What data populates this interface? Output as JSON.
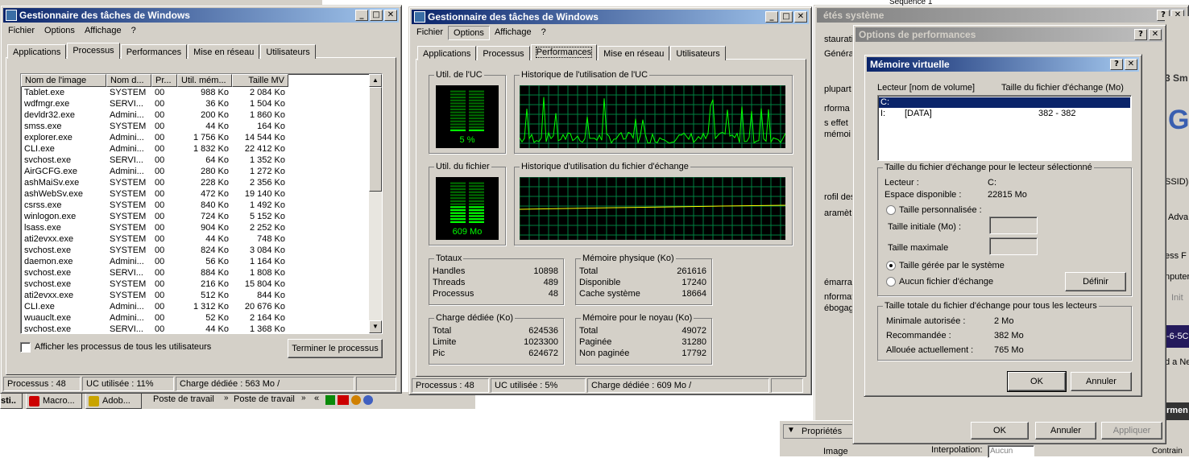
{
  "taskman_left": {
    "title": "Gestionnaire des tâches de Windows",
    "menu": [
      "Fichier",
      "Options",
      "Affichage",
      "?"
    ],
    "tabs": [
      "Applications",
      "Processus",
      "Performances",
      "Mise en réseau",
      "Utilisateurs"
    ],
    "active_tab": 1,
    "columns": [
      "Nom de l'image",
      "Nom d...",
      "Pr...",
      "Util. mém...",
      "Taille MV"
    ],
    "rows": [
      [
        "Tablet.exe",
        "SYSTEM",
        "00",
        "988 Ko",
        "2 084 Ko"
      ],
      [
        "wdfmgr.exe",
        "SERVI...",
        "00",
        "36 Ko",
        "1 504 Ko"
      ],
      [
        "devldr32.exe",
        "Admini...",
        "00",
        "200 Ko",
        "1 860 Ko"
      ],
      [
        "smss.exe",
        "SYSTEM",
        "00",
        "44 Ko",
        "164 Ko"
      ],
      [
        "explorer.exe",
        "Admini...",
        "00",
        "1 756 Ko",
        "14 544 Ko"
      ],
      [
        "CLI.exe",
        "Admini...",
        "00",
        "1 832 Ko",
        "22 412 Ko"
      ],
      [
        "svchost.exe",
        "SERVI...",
        "00",
        "64 Ko",
        "1 352 Ko"
      ],
      [
        "AirGCFG.exe",
        "Admini...",
        "00",
        "280 Ko",
        "1 272 Ko"
      ],
      [
        "ashMaiSv.exe",
        "SYSTEM",
        "00",
        "228 Ko",
        "2 356 Ko"
      ],
      [
        "ashWebSv.exe",
        "SYSTEM",
        "00",
        "472 Ko",
        "19 140 Ko"
      ],
      [
        "csrss.exe",
        "SYSTEM",
        "00",
        "840 Ko",
        "1 492 Ko"
      ],
      [
        "winlogon.exe",
        "SYSTEM",
        "00",
        "724 Ko",
        "5 152 Ko"
      ],
      [
        "lsass.exe",
        "SYSTEM",
        "00",
        "904 Ko",
        "2 252 Ko"
      ],
      [
        "ati2evxx.exe",
        "SYSTEM",
        "00",
        "44 Ko",
        "748 Ko"
      ],
      [
        "svchost.exe",
        "SYSTEM",
        "00",
        "824 Ko",
        "3 084 Ko"
      ],
      [
        "daemon.exe",
        "Admini...",
        "00",
        "56 Ko",
        "1 164 Ko"
      ],
      [
        "svchost.exe",
        "SERVI...",
        "00",
        "884 Ko",
        "1 808 Ko"
      ],
      [
        "svchost.exe",
        "SYSTEM",
        "00",
        "216 Ko",
        "15 804 Ko"
      ],
      [
        "ati2evxx.exe",
        "SYSTEM",
        "00",
        "512 Ko",
        "844 Ko"
      ],
      [
        "CLI.exe",
        "Admini...",
        "00",
        "1 312 Ko",
        "20 676 Ko"
      ],
      [
        "wuauclt.exe",
        "Admini...",
        "00",
        "52 Ko",
        "2 164 Ko"
      ],
      [
        "svchost.exe",
        "SERVI...",
        "00",
        "44 Ko",
        "1 368 Ko"
      ]
    ],
    "show_all_label": "Afficher les processus de tous les utilisateurs",
    "end_process_label": "Terminer le processus",
    "status": [
      "Processus : 48",
      "UC utilisée : 11%",
      "Charge dédiée : 563 Mo /"
    ]
  },
  "taskman_right": {
    "title": "Gestionnaire des tâches de Windows",
    "menu": [
      "Fichier",
      "Options",
      "Affichage",
      "?"
    ],
    "tabs": [
      "Applications",
      "Processus",
      "Performances",
      "Mise en réseau",
      "Utilisateurs"
    ],
    "active_tab": 2,
    "cpu_group": "Util. de l'UC",
    "cpu_value": "5 %",
    "cpu_level": 0.05,
    "cpu_history_group": "Historique de l'utilisation de l'UC",
    "pf_group": "Util. du fichier",
    "pf_value": "609 Mo",
    "pf_level": 0.45,
    "pf_history_group": "Historique d'utilisation du fichier d'échange",
    "totaux": {
      "title": "Totaux",
      "rows": [
        [
          "Handles",
          "10898"
        ],
        [
          "Threads",
          "489"
        ],
        [
          "Processus",
          "48"
        ]
      ]
    },
    "physical": {
      "title": "Mémoire physique (Ko)",
      "rows": [
        [
          "Total",
          "261616"
        ],
        [
          "Disponible",
          "17240"
        ],
        [
          "Cache système",
          "18664"
        ]
      ]
    },
    "commit": {
      "title": "Charge dédiée (Ko)",
      "rows": [
        [
          "Total",
          "624536"
        ],
        [
          "Limite",
          "1023300"
        ],
        [
          "Pic",
          "624672"
        ]
      ]
    },
    "kernel": {
      "title": "Mémoire pour le noyau (Ko)",
      "rows": [
        [
          "Total",
          "49072"
        ],
        [
          "Paginée",
          "31280"
        ],
        [
          "Non paginée",
          "17792"
        ]
      ]
    },
    "status": [
      "Processus : 48",
      "UC utilisée : 5%",
      "Charge dédiée : 609 Mo /"
    ]
  },
  "background": {
    "sysprops_title": "étés système",
    "sequence_label": "Séquence 1",
    "sys_fragments": [
      "staurati",
      "Généra",
      "plupart",
      "rforma",
      "s effet",
      "mémoi",
      "rofil des",
      "aramètr",
      "émarrag",
      "nformati",
      "ébogag"
    ],
    "right_fragments": [
      "3 Sm",
      "G",
      "SSID)",
      "Adva",
      "ess F",
      "nputer",
      "Init",
      "-6-5C",
      "d a Ne",
      "rmen"
    ],
    "perf_opts_title": "Options de performances",
    "perf_ok": "OK",
    "perf_cancel": "Annuler",
    "perf_apply": "Appliquer",
    "props_label": "Propriétés",
    "image_label": "Image",
    "interp_label": "Interpolation:",
    "interp_value": "Aucun",
    "constrain_label": "Contrain"
  },
  "vmem": {
    "title": "Mémoire virtuelle",
    "col_drive": "Lecteur [nom de volume]",
    "col_size": "Taille du fichier d'échange (Mo)",
    "drives": [
      {
        "drive": "C:",
        "label": "",
        "size": ""
      },
      {
        "drive": "I:",
        "label": "[DATA]",
        "size": "382 - 382"
      }
    ],
    "sel_group": "Taille du fichier d'échange pour le lecteur sélectionné",
    "drive_label": "Lecteur :",
    "drive_value": "C:",
    "space_label": "Espace disponible :",
    "space_value": "22815 Mo",
    "custom_label": "Taille personnalisée :",
    "initial_label": "Taille initiale (Mo) :",
    "max_label": "Taille maximale",
    "system_managed_label": "Taille gérée par le système",
    "no_file_label": "Aucun fichier d'échange",
    "set_button": "Définir",
    "total_group": "Taille totale du fichier d'échange pour tous les lecteurs",
    "min_label": "Minimale autorisée :",
    "min_value": "2 Mo",
    "rec_label": "Recommandée :",
    "rec_value": "382 Mo",
    "alloc_label": "Allouée actuellement :",
    "alloc_value": "765 Mo",
    "ok": "OK",
    "cancel": "Annuler"
  },
  "taskbar": {
    "start": "sti..",
    "items": [
      "Macro...",
      "Adob...",
      "Poste de travail",
      "Poste de travail"
    ]
  },
  "colors": {
    "graph_green": "#00ff00",
    "graph_grid": "#008040",
    "pf_line": "#ffff00",
    "title_active": "#0a246a",
    "title_inactive": "#808080"
  }
}
